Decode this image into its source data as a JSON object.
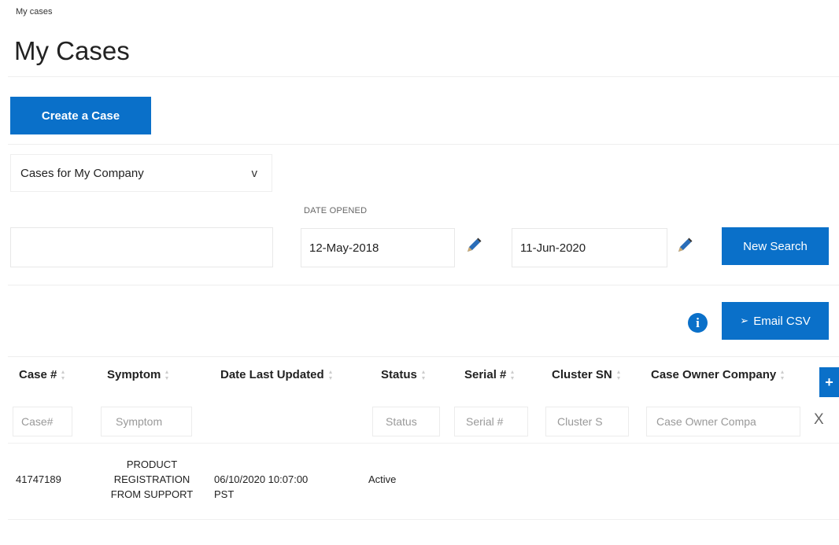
{
  "breadcrumb": "My cases",
  "page_title": "My Cases",
  "create_button": "Create a Case",
  "scope_select": {
    "value": "Cases for My Company",
    "chevron": "v"
  },
  "search": {
    "keyword_value": "",
    "date_label": "DATE OPENED",
    "date_from": "12-May-2018",
    "date_to": "11-Jun-2020",
    "new_search_label": "New Search"
  },
  "actions": {
    "info_icon": "i",
    "email_csv_label": "Email CSV",
    "send_icon": "➢"
  },
  "table": {
    "columns": [
      "Case #",
      "Symptom",
      "Date Last Updated",
      "Status",
      "Serial #",
      "Cluster SN",
      "Case Owner Company"
    ],
    "add_column_label": "+",
    "filters": [
      "Case#",
      "Symptom",
      "Status",
      "Serial #",
      "Cluster S",
      "Case Owner Compa"
    ],
    "clear_filters_label": "X",
    "rows": [
      {
        "case_no": "41747189",
        "symptom": [
          "PRODUCT",
          "REGISTRATION",
          "FROM SUPPORT"
        ],
        "date_last_updated": [
          "06/10/2020 10:07:00",
          "PST"
        ],
        "status": "Active"
      }
    ]
  },
  "colors": {
    "accent": "#0a70c9",
    "border": "#eeeeee"
  }
}
